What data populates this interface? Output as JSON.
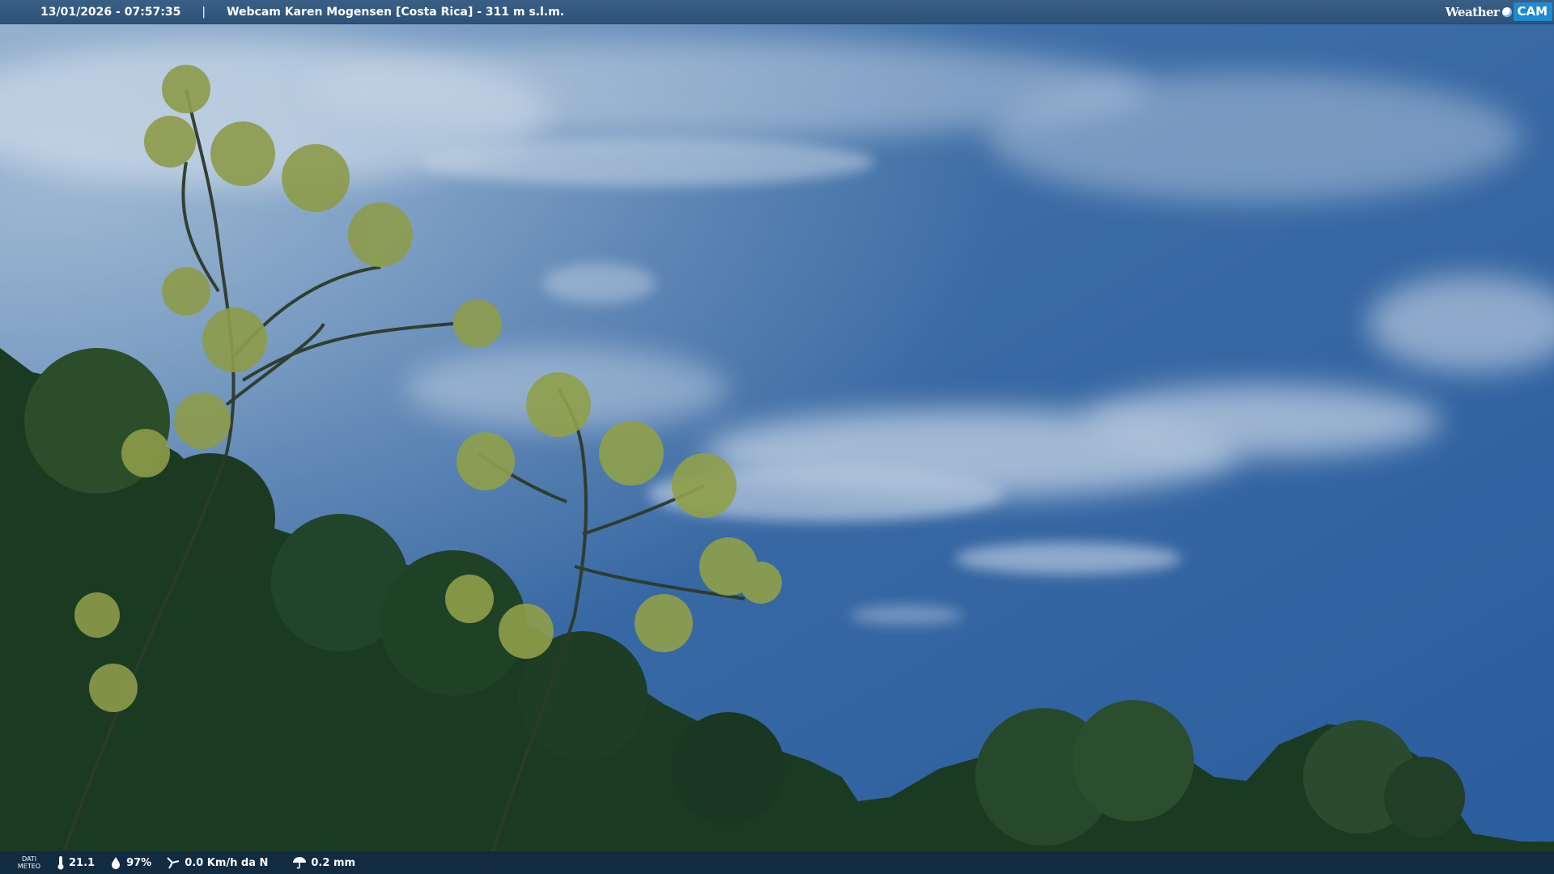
{
  "header": {
    "datetime": "13/01/2026 - 07:57:35",
    "separator": "|",
    "title": "Webcam Karen Mogensen [Costa Rica] - 311 m s.l.m."
  },
  "brand": {
    "weather": "Weather",
    "cam": "CAM",
    "accent_color": "#1e8ad3"
  },
  "weather_bar": {
    "label": "DATI METEO",
    "temperature": "21.1",
    "humidity": "97%",
    "wind": "0.0 Km/h da N",
    "rain": "0.2 mm"
  },
  "scene": {
    "sky_color": "#2f5f9a",
    "foliage_color": "#1b3a22"
  }
}
